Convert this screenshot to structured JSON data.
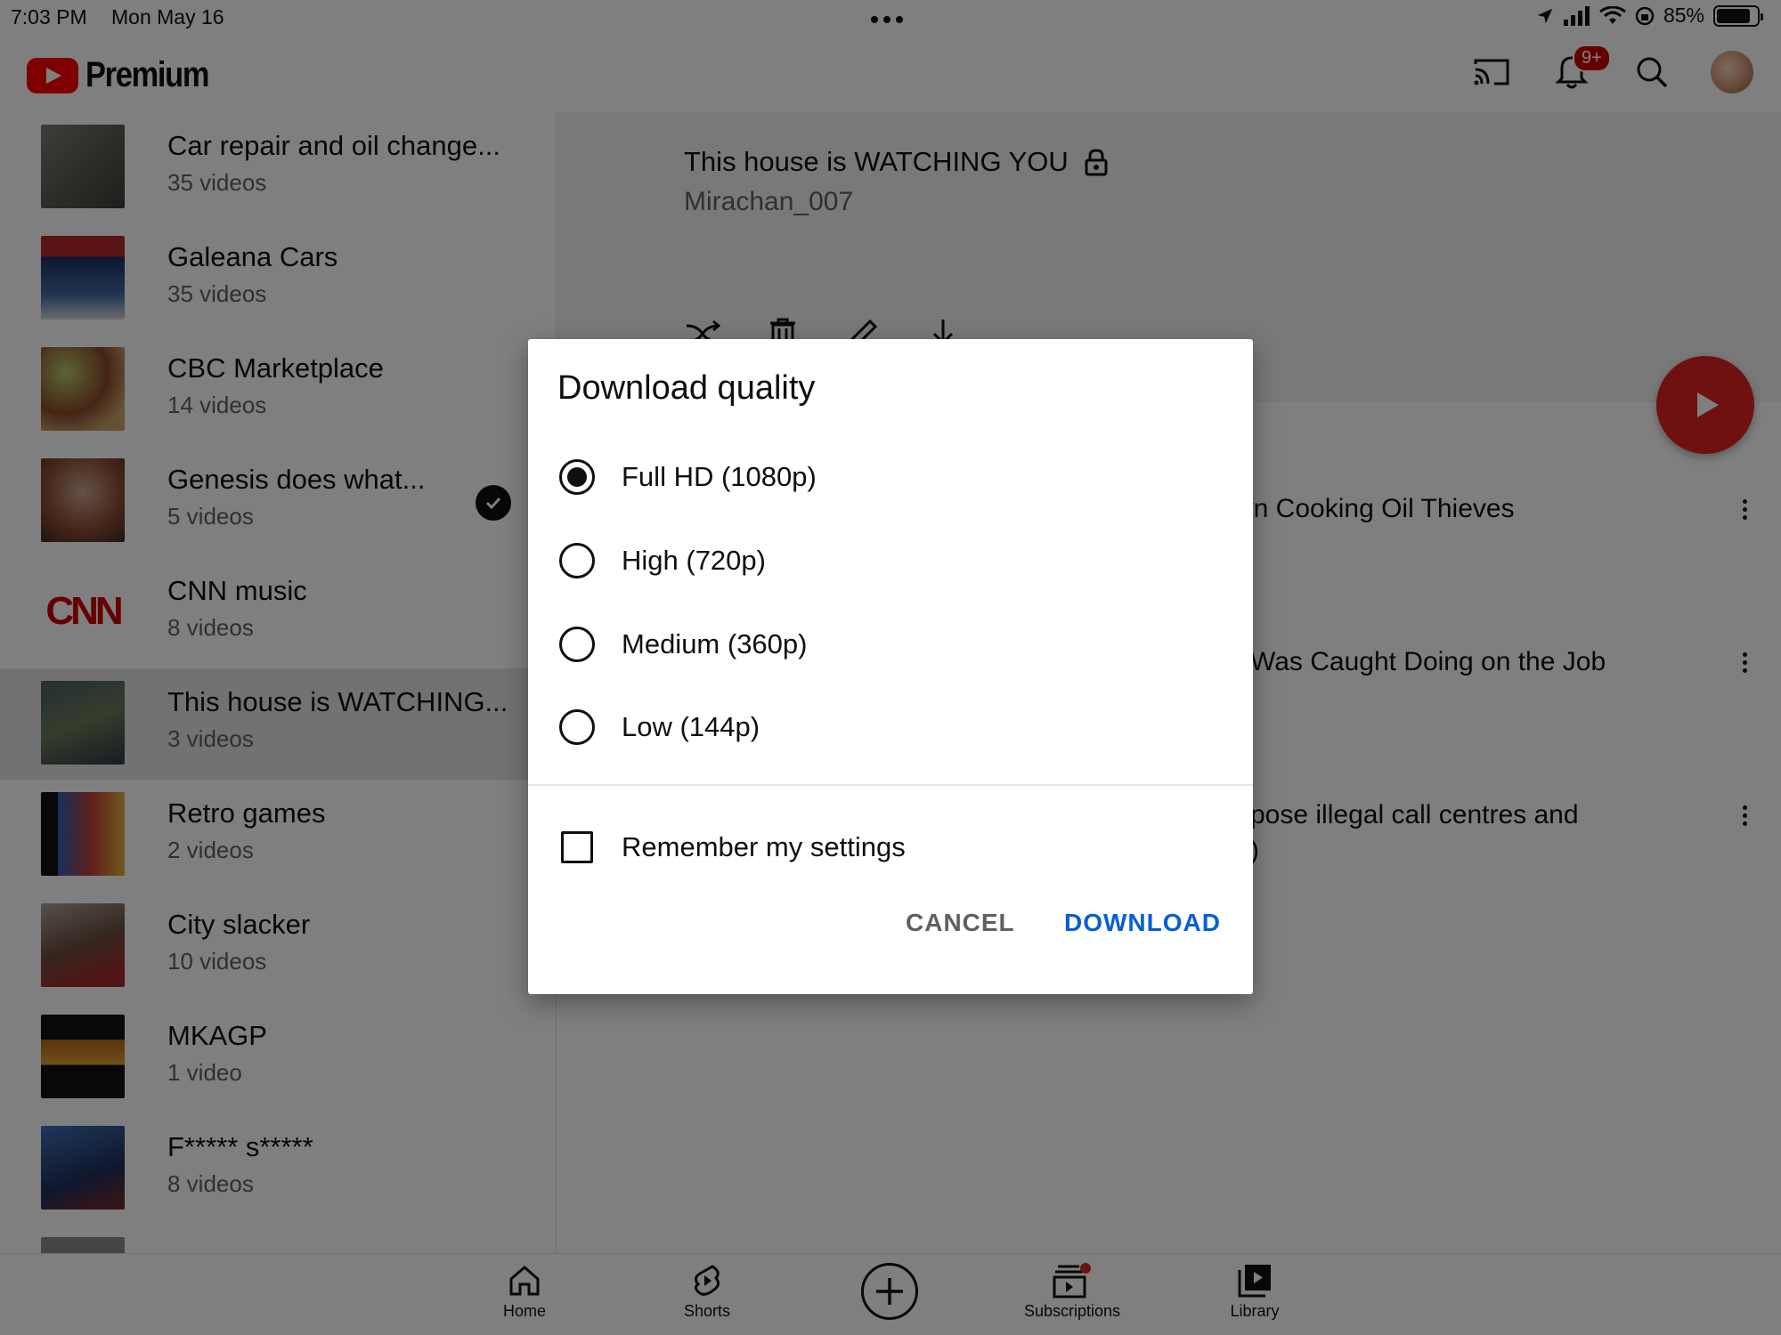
{
  "status_bar": {
    "time": "7:03 PM",
    "date": "Mon May 16",
    "battery": "85%",
    "battery_level": 0.85
  },
  "app": {
    "logo_text": "Premium",
    "notification_badge": "9+",
    "brand_color": "#ff0000"
  },
  "playlists": [
    {
      "title": "Car repair and oil change...",
      "count": "35 videos",
      "thumb": "#5b5b55"
    },
    {
      "title": "Galeana Cars",
      "count": "35 videos",
      "thumb": "#2d4a7a"
    },
    {
      "title": "CBC Marketplace",
      "count": "14 videos",
      "thumb": "#8c6a3c"
    },
    {
      "title": "Genesis does what...",
      "count": "5 videos",
      "thumb": "#9a6547",
      "checked": true
    },
    {
      "title": "CNN music",
      "count": "8 videos",
      "thumb": "#ffffff"
    },
    {
      "title": "This house is WATCHING...",
      "count": "3 videos",
      "thumb": "#56606b",
      "selected": true
    },
    {
      "title": "Retro games",
      "count": "2 videos",
      "thumb": "#1d3c78"
    },
    {
      "title": "City slacker",
      "count": "10 videos",
      "thumb": "#6e5e54"
    },
    {
      "title": "MKAGP",
      "count": "1 video",
      "thumb": "#151515"
    },
    {
      "title": "F***** s*****",
      "count": "8 videos",
      "thumb": "#2c4f86"
    }
  ],
  "playlist_detail": {
    "title": "This house is WATCHING YOU",
    "owner": "Mirachan_007",
    "videos": [
      {
        "title": "wn Cooking Oil Thieves"
      },
      {
        "title": " Was Caught Doing on the Job"
      },
      {
        "title": "pose illegal call centres and",
        "line2": ")"
      }
    ]
  },
  "dialog": {
    "title": "Download quality",
    "options": [
      {
        "label": "Full HD (1080p)",
        "checked": true
      },
      {
        "label": "High (720p)",
        "checked": false
      },
      {
        "label": "Medium (360p)",
        "checked": false
      },
      {
        "label": "Low (144p)",
        "checked": false
      }
    ],
    "remember_label": "Remember my settings",
    "remember_checked": false,
    "cancel_label": "CANCEL",
    "download_label": "DOWNLOAD",
    "accent_color": "#065fd4"
  },
  "bottom_nav": {
    "home": "Home",
    "shorts": "Shorts",
    "subscriptions": "Subscriptions",
    "library": "Library"
  }
}
